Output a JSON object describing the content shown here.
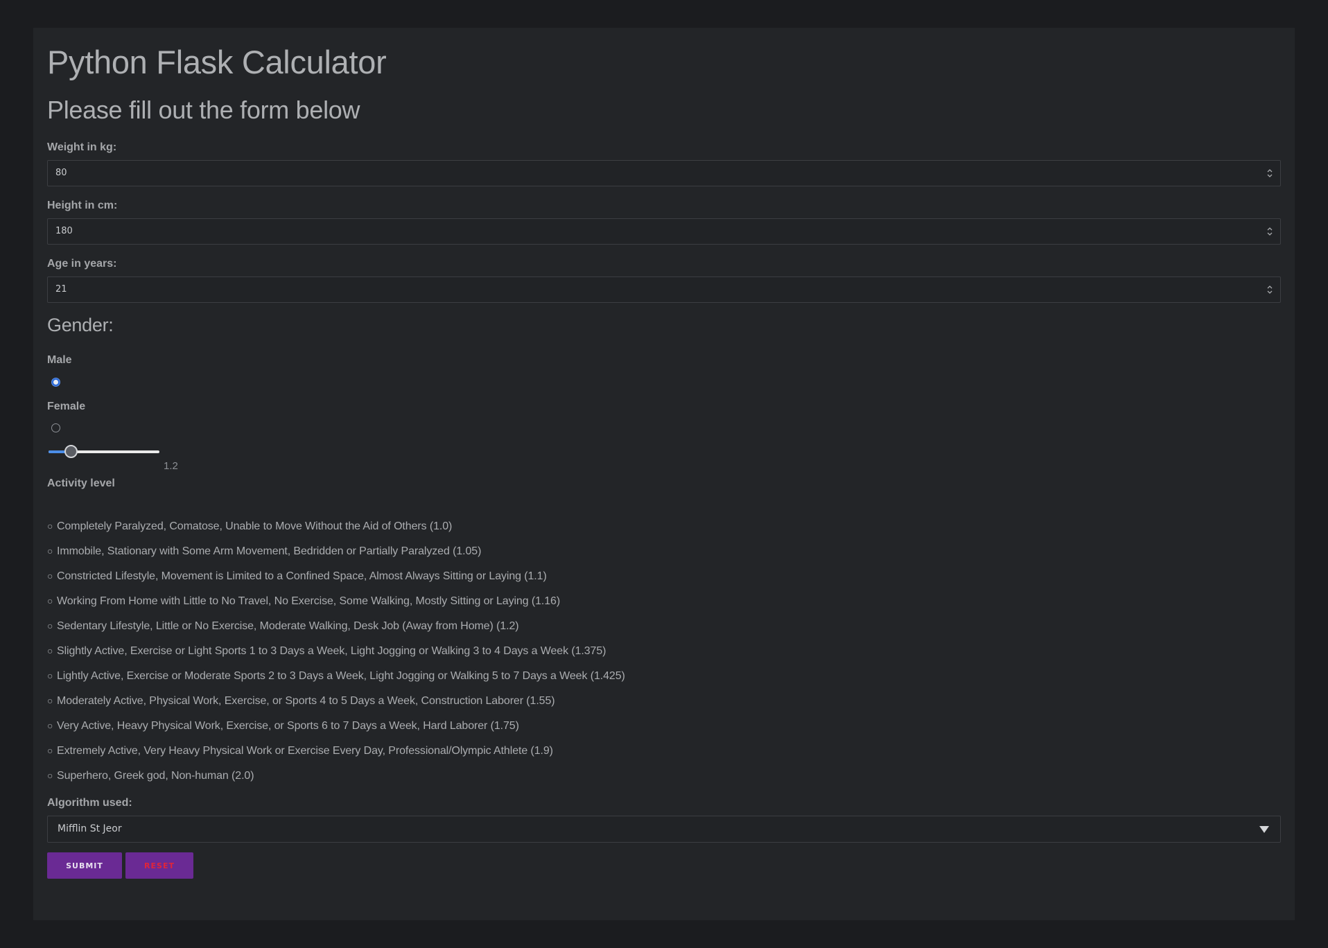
{
  "header": {
    "title": "Python Flask Calculator",
    "subtitle": "Please fill out the form below"
  },
  "form": {
    "weight": {
      "label": "Weight in kg:",
      "value": "80"
    },
    "height": {
      "label": "Height in cm:",
      "value": "180"
    },
    "age": {
      "label": "Age in years:",
      "value": "21"
    },
    "gender": {
      "heading": "Gender:",
      "male_label": "Male",
      "female_label": "Female",
      "selected": "Male"
    },
    "activity": {
      "slider_value": "1.2",
      "slider_fraction": 0.2,
      "label": "Activity level",
      "options": [
        "Completely Paralyzed, Comatose, Unable to Move Without the Aid of Others (1.0)",
        "Immobile, Stationary with Some Arm Movement, Bedridden or Partially Paralyzed (1.05)",
        "Constricted Lifestyle, Movement is Limited to a Confined Space, Almost Always Sitting or Laying (1.1)",
        "Working From Home with Little to No Travel, No Exercise, Some Walking, Mostly Sitting or Laying (1.16)",
        "Sedentary Lifestyle, Little or No Exercise, Moderate Walking, Desk Job (Away from Home) (1.2)",
        "Slightly Active, Exercise or Light Sports 1 to 3 Days a Week, Light Jogging or Walking 3 to 4 Days a Week (1.375)",
        "Lightly Active, Exercise or Moderate Sports 2 to 3 Days a Week, Light Jogging or Walking 5 to 7 Days a Week (1.425)",
        "Moderately Active, Physical Work, Exercise, or Sports 4 to 5 Days a Week, Construction Laborer (1.55)",
        "Very Active, Heavy Physical Work, Exercise, or Sports 6 to 7 Days a Week, Hard Laborer (1.75)",
        "Extremely Active, Very Heavy Physical Work or Exercise Every Day, Professional/Olympic Athlete (1.9)",
        "Superhero, Greek god, Non-human (2.0)"
      ]
    },
    "algorithm": {
      "label": "Algorithm used:",
      "selected": "Mifflin St Jeor"
    }
  },
  "buttons": {
    "submit_label": "SUBMIT",
    "reset_label": "RESET"
  },
  "colors": {
    "page_bg": "#1b1c1f",
    "card_bg": "#232528",
    "button_bg": "#6a2a94",
    "reset_text": "#e0243a",
    "radio_accent": "#2a69d6",
    "slider_fill": "#4c8ee8"
  },
  "icons": {
    "spinner": "spinner-updown-icon",
    "caret": "caret-down-icon",
    "bullet": "circle-bullet-icon"
  }
}
